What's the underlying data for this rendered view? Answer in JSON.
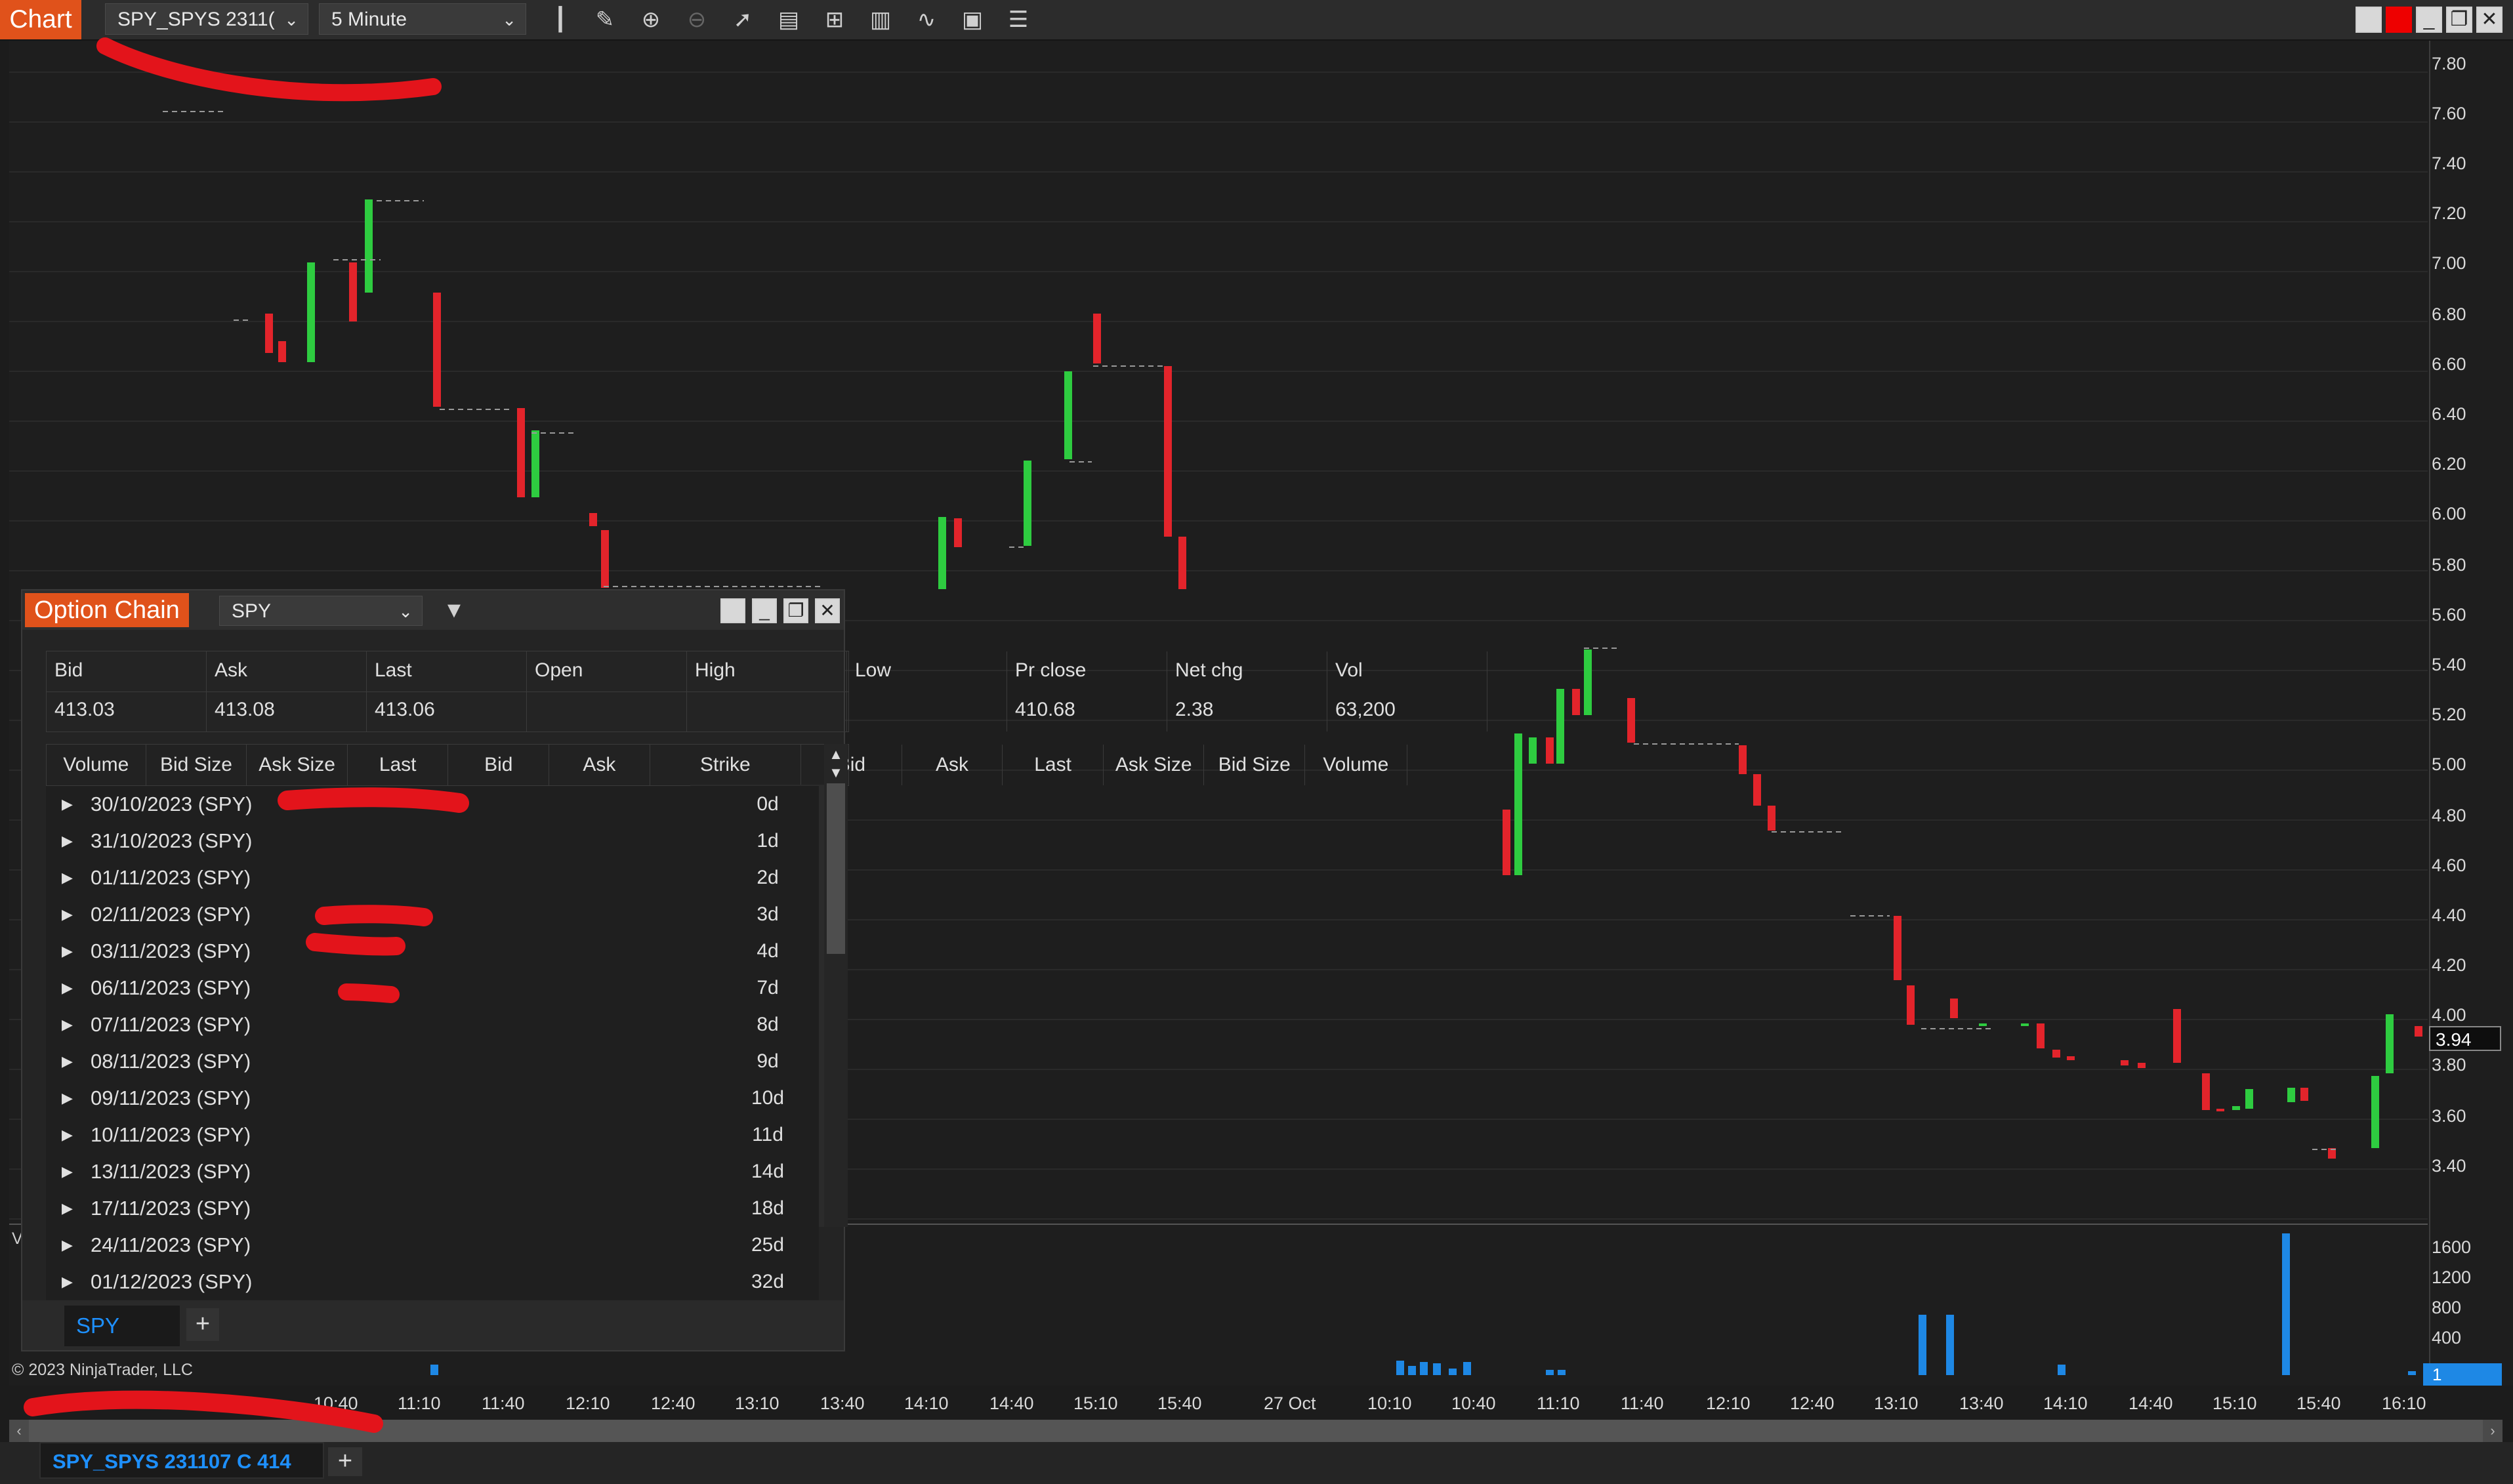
{
  "toolbar": {
    "chart_tab": "Chart",
    "instrument": "SPY_SPYS 2311(",
    "interval": "5 Minute",
    "icons": [
      "bar-type-icon",
      "draw-tool-icon",
      "zoom-in-icon",
      "zoom-out-icon",
      "pointer-icon",
      "data-box-icon",
      "templates-icon",
      "properties-icon",
      "indicators-icon",
      "strategies-icon",
      "list-icon"
    ]
  },
  "price_axis": [
    "7.80",
    "7.60",
    "7.40",
    "7.20",
    "7.00",
    "6.80",
    "6.60",
    "6.40",
    "6.20",
    "6.00",
    "5.80",
    "5.60",
    "5.40",
    "5.20",
    "5.00",
    "4.80",
    "4.60",
    "4.40",
    "4.20",
    "4.00",
    "3.80",
    "3.60",
    "3.40"
  ],
  "last_price": "3.94",
  "volume_axis": [
    "1600",
    "1200",
    "800",
    "400"
  ],
  "last_volume": "1",
  "time_axis": [
    "10:40",
    "11:10",
    "11:40",
    "12:10",
    "12:40",
    "13:10",
    "13:40",
    "14:10",
    "14:40",
    "15:10",
    "15:40",
    "27 Oct",
    "10:10",
    "10:40",
    "11:10",
    "11:40",
    "12:10",
    "12:40",
    "13:10",
    "13:40",
    "14:10",
    "14:40",
    "15:10",
    "15:40",
    "16:10"
  ],
  "copyright": "© 2023 NinjaTrader, LLC",
  "v_marker": "V",
  "bottom_tab": "SPY_SPYS 231107 C 414",
  "option_chain": {
    "title": "Option Chain",
    "symbol": "SPY",
    "quote_headers": [
      "Bid",
      "Ask",
      "Last",
      "Open",
      "High",
      "Low",
      "Pr close",
      "Net chg",
      "Vol"
    ],
    "quote_values": [
      "413.03",
      "413.08",
      "413.06",
      "",
      "",
      "",
      "410.68",
      "2.38",
      "63,200"
    ],
    "grid_headers": [
      "Volume",
      "Bid Size",
      "Ask Size",
      "Last",
      "Bid",
      "Ask",
      "Strike",
      "Bid",
      "Ask",
      "Last",
      "Ask Size",
      "Bid Size",
      "Volume"
    ],
    "rows": [
      {
        "date": "30/10/2023  (SPY)",
        "strike": "0d"
      },
      {
        "date": "31/10/2023  (SPY)",
        "strike": "1d"
      },
      {
        "date": "01/11/2023  (SPY)",
        "strike": "2d"
      },
      {
        "date": "02/11/2023  (SPY)",
        "strike": "3d"
      },
      {
        "date": "03/11/2023  (SPY)",
        "strike": "4d"
      },
      {
        "date": "06/11/2023  (SPY)",
        "strike": "7d"
      },
      {
        "date": "07/11/2023  (SPY)",
        "strike": "8d"
      },
      {
        "date": "08/11/2023  (SPY)",
        "strike": "9d"
      },
      {
        "date": "09/11/2023  (SPY)",
        "strike": "10d"
      },
      {
        "date": "10/11/2023  (SPY)",
        "strike": "11d"
      },
      {
        "date": "13/11/2023  (SPY)",
        "strike": "14d"
      },
      {
        "date": "17/11/2023  (SPY)",
        "strike": "18d"
      },
      {
        "date": "24/11/2023  (SPY)",
        "strike": "25d"
      },
      {
        "date": "01/12/2023  (SPY)",
        "strike": "32d"
      }
    ],
    "bottom_tab": "SPY"
  },
  "colors": {
    "accent": "#e0521b",
    "up": "#2ecc40",
    "down": "#e3242b",
    "volume": "#1e88e5",
    "tab_text": "#1e90ff"
  }
}
